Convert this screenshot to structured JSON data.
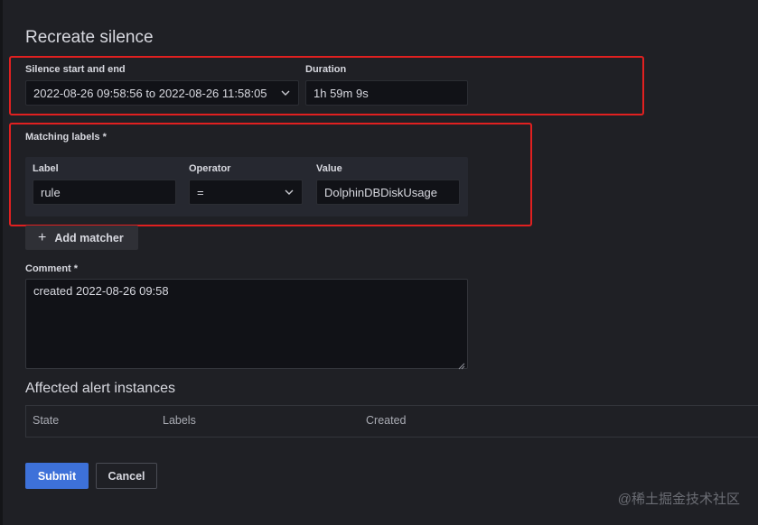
{
  "page_title": "Recreate silence",
  "silence": {
    "start_end_label": "Silence start and end",
    "start_end_value": "2022-08-26 09:58:56 to 2022-08-26 11:58:05",
    "duration_label": "Duration",
    "duration_value": "1h 59m 9s"
  },
  "matching": {
    "section_label": "Matching labels *",
    "label_header": "Label",
    "label_value": "rule",
    "operator_header": "Operator",
    "operator_value": "=",
    "value_header": "Value",
    "value_value": "DolphinDBDiskUsage",
    "add_matcher": "Add matcher"
  },
  "comment": {
    "label": "Comment *",
    "value": "created 2022-08-26 09:58"
  },
  "affected": {
    "heading": "Affected alert instances",
    "columns": [
      "State",
      "Labels",
      "Created"
    ]
  },
  "actions": {
    "submit": "Submit",
    "cancel": "Cancel"
  },
  "watermark": "@稀土掘金技术社区",
  "colors": {
    "background": "#1f2025",
    "input_bg": "#111217",
    "primary": "#3d71d9",
    "highlight_box": "#e02020"
  },
  "icons": [
    "chevron-down-icon",
    "plus-icon",
    "resize-grip-icon"
  ]
}
